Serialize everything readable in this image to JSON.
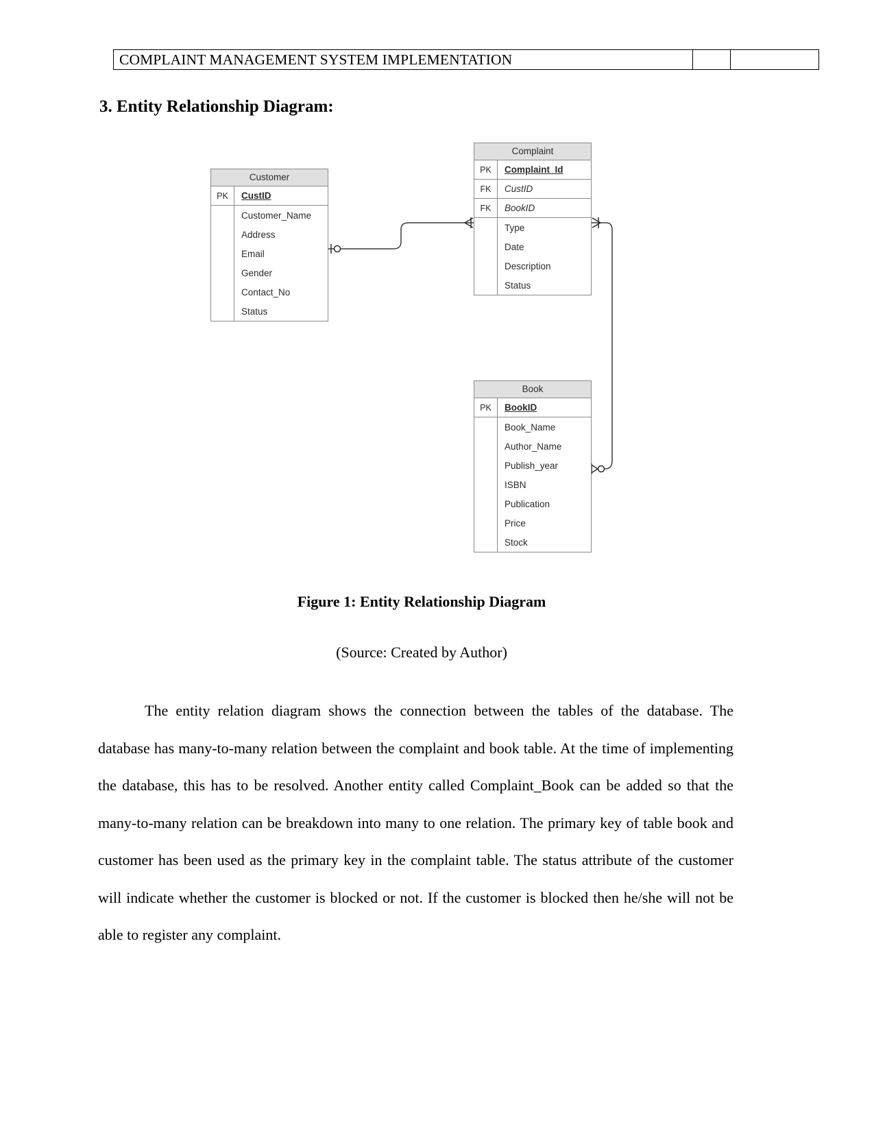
{
  "page": {
    "background": "#ffffff",
    "text_color": "#000000"
  },
  "header": {
    "title": "COMPLAINT MANAGEMENT SYSTEM IMPLEMENTATION",
    "blank_cell_1": "",
    "blank_cell_2": ""
  },
  "section": {
    "heading": "3. Entity Relationship Diagram:"
  },
  "figure": {
    "caption": "Figure 1: Entity Relationship Diagram",
    "source": "(Source: Created by Author)"
  },
  "body": {
    "paragraph": "The entity relation diagram shows the connection between the tables of the database. The database has many-to-many relation between the complaint and book table. At the time of implementing the database, this has to be resolved. Another entity called Complaint_Book can be added so that the many-to-many relation can be breakdown into many to one relation. The primary key of table book and customer has been used as the primary key in the complaint table. The status attribute of the customer will indicate whether the customer is blocked or not. If the customer is blocked then he/she will not be able to register any complaint."
  },
  "diagram": {
    "type": "entity-relationship",
    "header_fill": "#e0e0e0",
    "border_color": "#8a8a8a",
    "line_color": "#3a3a3a",
    "entities": [
      {
        "name": "Customer",
        "fields": [
          {
            "key": "PK",
            "name": "CustID",
            "style": "pk"
          },
          {
            "key": "",
            "name": "Customer_Name",
            "style": "plain"
          },
          {
            "key": "",
            "name": "Address",
            "style": "plain"
          },
          {
            "key": "",
            "name": "Email",
            "style": "plain"
          },
          {
            "key": "",
            "name": "Gender",
            "style": "plain"
          },
          {
            "key": "",
            "name": "Contact_No",
            "style": "plain"
          },
          {
            "key": "",
            "name": "Status",
            "style": "plain"
          }
        ]
      },
      {
        "name": "Complaint",
        "fields": [
          {
            "key": "PK",
            "name": "Complaint_Id",
            "style": "pk"
          },
          {
            "key": "FK",
            "name": "CustID",
            "style": "fk"
          },
          {
            "key": "FK",
            "name": "BookID",
            "style": "fk"
          },
          {
            "key": "",
            "name": "Type",
            "style": "plain"
          },
          {
            "key": "",
            "name": "Date",
            "style": "plain"
          },
          {
            "key": "",
            "name": "Description",
            "style": "plain"
          },
          {
            "key": "",
            "name": "Status",
            "style": "plain"
          }
        ]
      },
      {
        "name": "Book",
        "fields": [
          {
            "key": "PK",
            "name": "BookID",
            "style": "pk"
          },
          {
            "key": "",
            "name": "Book_Name",
            "style": "plain"
          },
          {
            "key": "",
            "name": "Author_Name",
            "style": "plain"
          },
          {
            "key": "",
            "name": "Publish_year",
            "style": "plain"
          },
          {
            "key": "",
            "name": "ISBN",
            "style": "plain"
          },
          {
            "key": "",
            "name": "Publication",
            "style": "plain"
          },
          {
            "key": "",
            "name": "Price",
            "style": "plain"
          },
          {
            "key": "",
            "name": "Stock",
            "style": "plain"
          }
        ]
      }
    ],
    "relationships": [
      {
        "from": "Customer",
        "to": "Complaint",
        "from_cardinality": "one-or-zero",
        "to_cardinality": "many"
      },
      {
        "from": "Complaint",
        "to": "Book",
        "from_cardinality": "many",
        "to_cardinality": "zero-or-many"
      }
    ]
  }
}
